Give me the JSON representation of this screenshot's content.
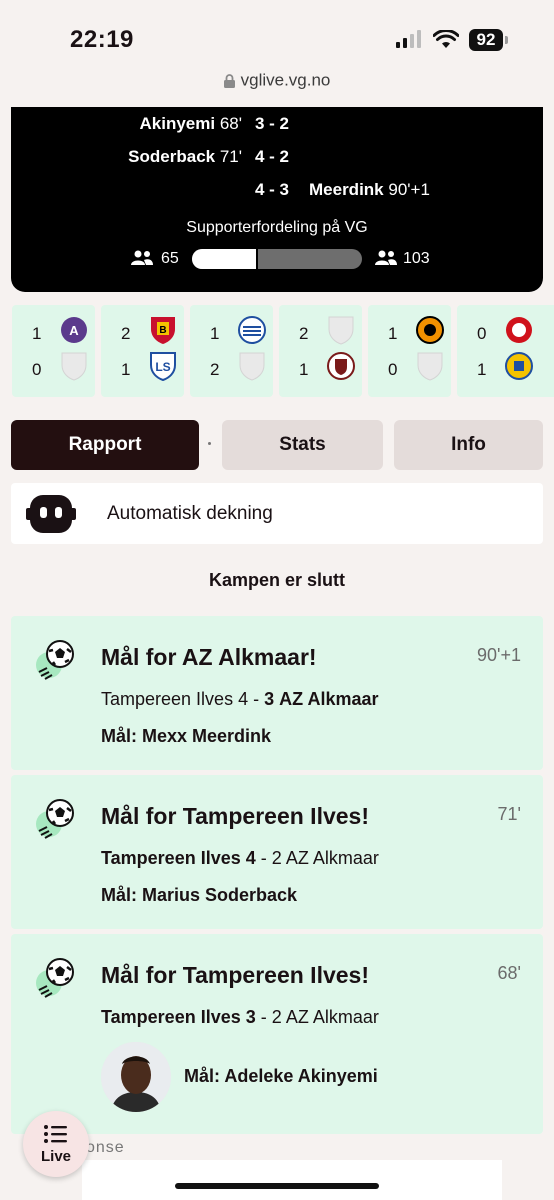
{
  "status_bar": {
    "time": "22:19",
    "battery": "92"
  },
  "browser": {
    "url": "vglive.vg.no"
  },
  "score_card": {
    "goals": [
      {
        "scorer": "Akinyemi",
        "minute": "68'",
        "score": "3 - 2",
        "side": "home"
      },
      {
        "scorer": "Soderback",
        "minute": "71'",
        "score": "4 - 2",
        "side": "home"
      },
      {
        "scorer": "Meerdink",
        "minute": "90'+1",
        "score": "4 - 3",
        "side": "away"
      }
    ],
    "supporter_title": "Supporterfordeling på VG",
    "home_supporters": "65",
    "away_supporters": "103",
    "home_share": 0.387
  },
  "mini_scores": [
    {
      "home": "1",
      "away": "0",
      "colors": [
        "#5b3a8c",
        "#ececec"
      ]
    },
    {
      "home": "2",
      "away": "1",
      "colors": [
        "#c8102e",
        "#1f4fa0"
      ]
    },
    {
      "home": "1",
      "away": "2",
      "colors": [
        "#1f4fa0",
        "#ececec"
      ]
    },
    {
      "home": "2",
      "away": "1",
      "colors": [
        "#ececec",
        "#7a1a1a"
      ]
    },
    {
      "home": "1",
      "away": "0",
      "colors": [
        "#f29100",
        "#ececec"
      ]
    },
    {
      "home": "0",
      "away": "1",
      "colors": [
        "#d0111b",
        "#f4c300"
      ]
    }
  ],
  "tabs": [
    {
      "label": "Rapport",
      "active": true
    },
    {
      "label": "Stats",
      "active": false
    },
    {
      "label": "Info",
      "active": false
    }
  ],
  "auto_coverage": "Automatisk dekning",
  "match_ended": "Kampen er slutt",
  "events": [
    {
      "title": "Mål for AZ Alkmaar!",
      "minute": "90'+1",
      "home_team": "Tampereen Ilves",
      "home_goals": "4",
      "sep": " - ",
      "away_goals": "3",
      "away_team": "AZ Alkmaar",
      "scorer": "Mål: Mexx Meerdink"
    },
    {
      "title": "Mål for Tampereen Ilves!",
      "minute": "71'",
      "home_team": "Tampereen Ilves",
      "home_goals": "4",
      "sep": " - ",
      "away_goals": "2",
      "away_team": "AZ Alkmaar",
      "scorer": "Mål: Marius Soderback"
    },
    {
      "title": "Mål for Tampereen Ilves!",
      "minute": "68'",
      "home_team": "Tampereen Ilves",
      "home_goals": "3",
      "sep": " - ",
      "away_goals": "2",
      "away_team": "AZ Alkmaar",
      "scorer": "Mål: Adeleke Akinyemi"
    }
  ],
  "live_button": "Live",
  "ad_label": "onse",
  "colors": {
    "accent_dark": "#230f10",
    "event_bg": "#dff7ea",
    "page_bg": "#f6f2f0"
  }
}
